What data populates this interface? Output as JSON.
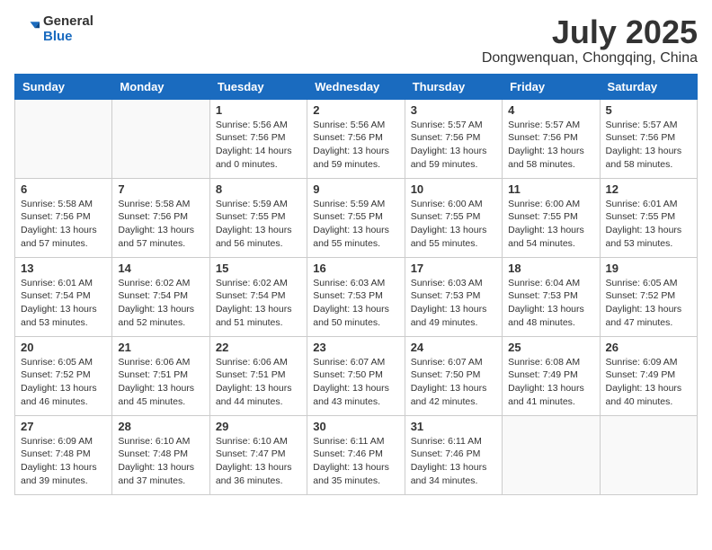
{
  "logo": {
    "general": "General",
    "blue": "Blue"
  },
  "title": {
    "month_year": "July 2025",
    "location": "Dongwenquan, Chongqing, China"
  },
  "weekdays": [
    "Sunday",
    "Monday",
    "Tuesday",
    "Wednesday",
    "Thursday",
    "Friday",
    "Saturday"
  ],
  "weeks": [
    [
      {
        "day": "",
        "info": ""
      },
      {
        "day": "",
        "info": ""
      },
      {
        "day": "1",
        "info": "Sunrise: 5:56 AM\nSunset: 7:56 PM\nDaylight: 14 hours\nand 0 minutes."
      },
      {
        "day": "2",
        "info": "Sunrise: 5:56 AM\nSunset: 7:56 PM\nDaylight: 13 hours\nand 59 minutes."
      },
      {
        "day": "3",
        "info": "Sunrise: 5:57 AM\nSunset: 7:56 PM\nDaylight: 13 hours\nand 59 minutes."
      },
      {
        "day": "4",
        "info": "Sunrise: 5:57 AM\nSunset: 7:56 PM\nDaylight: 13 hours\nand 58 minutes."
      },
      {
        "day": "5",
        "info": "Sunrise: 5:57 AM\nSunset: 7:56 PM\nDaylight: 13 hours\nand 58 minutes."
      }
    ],
    [
      {
        "day": "6",
        "info": "Sunrise: 5:58 AM\nSunset: 7:56 PM\nDaylight: 13 hours\nand 57 minutes."
      },
      {
        "day": "7",
        "info": "Sunrise: 5:58 AM\nSunset: 7:56 PM\nDaylight: 13 hours\nand 57 minutes."
      },
      {
        "day": "8",
        "info": "Sunrise: 5:59 AM\nSunset: 7:55 PM\nDaylight: 13 hours\nand 56 minutes."
      },
      {
        "day": "9",
        "info": "Sunrise: 5:59 AM\nSunset: 7:55 PM\nDaylight: 13 hours\nand 55 minutes."
      },
      {
        "day": "10",
        "info": "Sunrise: 6:00 AM\nSunset: 7:55 PM\nDaylight: 13 hours\nand 55 minutes."
      },
      {
        "day": "11",
        "info": "Sunrise: 6:00 AM\nSunset: 7:55 PM\nDaylight: 13 hours\nand 54 minutes."
      },
      {
        "day": "12",
        "info": "Sunrise: 6:01 AM\nSunset: 7:55 PM\nDaylight: 13 hours\nand 53 minutes."
      }
    ],
    [
      {
        "day": "13",
        "info": "Sunrise: 6:01 AM\nSunset: 7:54 PM\nDaylight: 13 hours\nand 53 minutes."
      },
      {
        "day": "14",
        "info": "Sunrise: 6:02 AM\nSunset: 7:54 PM\nDaylight: 13 hours\nand 52 minutes."
      },
      {
        "day": "15",
        "info": "Sunrise: 6:02 AM\nSunset: 7:54 PM\nDaylight: 13 hours\nand 51 minutes."
      },
      {
        "day": "16",
        "info": "Sunrise: 6:03 AM\nSunset: 7:53 PM\nDaylight: 13 hours\nand 50 minutes."
      },
      {
        "day": "17",
        "info": "Sunrise: 6:03 AM\nSunset: 7:53 PM\nDaylight: 13 hours\nand 49 minutes."
      },
      {
        "day": "18",
        "info": "Sunrise: 6:04 AM\nSunset: 7:53 PM\nDaylight: 13 hours\nand 48 minutes."
      },
      {
        "day": "19",
        "info": "Sunrise: 6:05 AM\nSunset: 7:52 PM\nDaylight: 13 hours\nand 47 minutes."
      }
    ],
    [
      {
        "day": "20",
        "info": "Sunrise: 6:05 AM\nSunset: 7:52 PM\nDaylight: 13 hours\nand 46 minutes."
      },
      {
        "day": "21",
        "info": "Sunrise: 6:06 AM\nSunset: 7:51 PM\nDaylight: 13 hours\nand 45 minutes."
      },
      {
        "day": "22",
        "info": "Sunrise: 6:06 AM\nSunset: 7:51 PM\nDaylight: 13 hours\nand 44 minutes."
      },
      {
        "day": "23",
        "info": "Sunrise: 6:07 AM\nSunset: 7:50 PM\nDaylight: 13 hours\nand 43 minutes."
      },
      {
        "day": "24",
        "info": "Sunrise: 6:07 AM\nSunset: 7:50 PM\nDaylight: 13 hours\nand 42 minutes."
      },
      {
        "day": "25",
        "info": "Sunrise: 6:08 AM\nSunset: 7:49 PM\nDaylight: 13 hours\nand 41 minutes."
      },
      {
        "day": "26",
        "info": "Sunrise: 6:09 AM\nSunset: 7:49 PM\nDaylight: 13 hours\nand 40 minutes."
      }
    ],
    [
      {
        "day": "27",
        "info": "Sunrise: 6:09 AM\nSunset: 7:48 PM\nDaylight: 13 hours\nand 39 minutes."
      },
      {
        "day": "28",
        "info": "Sunrise: 6:10 AM\nSunset: 7:48 PM\nDaylight: 13 hours\nand 37 minutes."
      },
      {
        "day": "29",
        "info": "Sunrise: 6:10 AM\nSunset: 7:47 PM\nDaylight: 13 hours\nand 36 minutes."
      },
      {
        "day": "30",
        "info": "Sunrise: 6:11 AM\nSunset: 7:46 PM\nDaylight: 13 hours\nand 35 minutes."
      },
      {
        "day": "31",
        "info": "Sunrise: 6:11 AM\nSunset: 7:46 PM\nDaylight: 13 hours\nand 34 minutes."
      },
      {
        "day": "",
        "info": ""
      },
      {
        "day": "",
        "info": ""
      }
    ]
  ]
}
